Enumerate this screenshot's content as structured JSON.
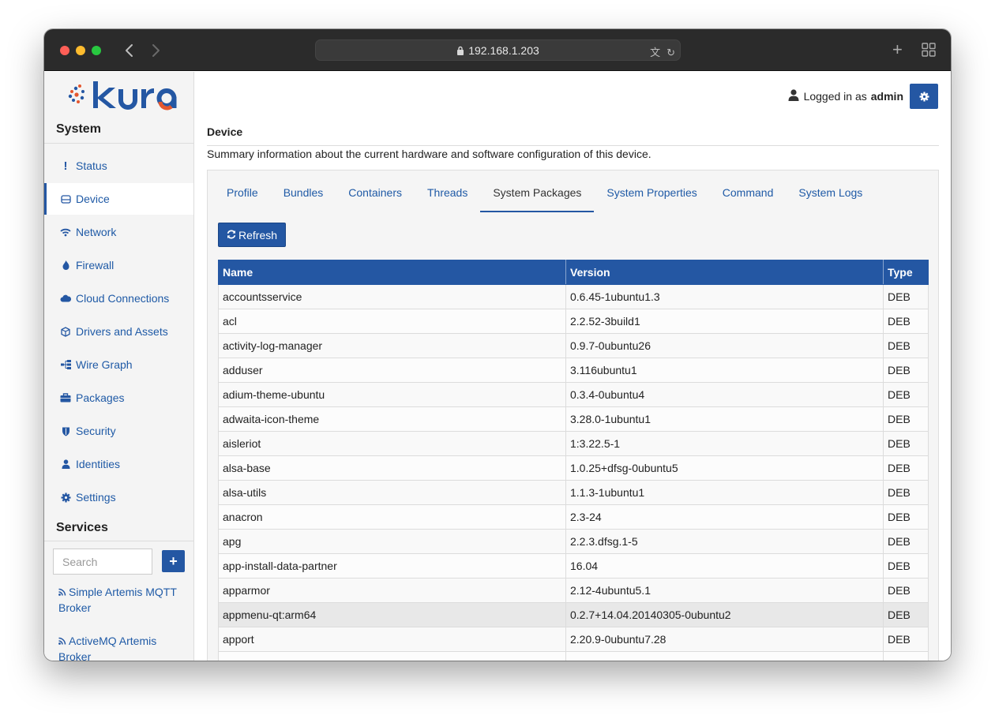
{
  "browser": {
    "url": "192.168.1.203",
    "colors": {
      "close": "#ff5f57",
      "minimize": "#febc2e",
      "maximize": "#28c840"
    }
  },
  "sidebar": {
    "system_heading": "System",
    "items": [
      {
        "label": "Status",
        "icon": "exclamation-icon"
      },
      {
        "label": "Device",
        "icon": "hdd-icon",
        "active": true
      },
      {
        "label": "Network",
        "icon": "wifi-icon"
      },
      {
        "label": "Firewall",
        "icon": "fire-icon"
      },
      {
        "label": "Cloud Connections",
        "icon": "cloud-icon"
      },
      {
        "label": "Drivers and Assets",
        "icon": "cube-icon"
      },
      {
        "label": "Wire Graph",
        "icon": "sitemap-icon"
      },
      {
        "label": "Packages",
        "icon": "briefcase-icon"
      },
      {
        "label": "Security",
        "icon": "shield-icon"
      },
      {
        "label": "Identities",
        "icon": "user-icon"
      },
      {
        "label": "Settings",
        "icon": "cog-icon"
      }
    ],
    "services_heading": "Services",
    "search_placeholder": "Search",
    "add_label": "+",
    "services": [
      {
        "label": "Simple Artemis MQTT Broker",
        "icon": "rss-icon"
      },
      {
        "label": "ActiveMQ Artemis Broker",
        "icon": "rss-icon"
      }
    ]
  },
  "header": {
    "logged_in_text": "Logged in as",
    "username": "admin"
  },
  "main": {
    "title": "Device",
    "description": "Summary information about the current hardware and software configuration of this device.",
    "tabs": [
      {
        "label": "Profile"
      },
      {
        "label": "Bundles"
      },
      {
        "label": "Containers"
      },
      {
        "label": "Threads"
      },
      {
        "label": "System Packages",
        "active": true
      },
      {
        "label": "System Properties"
      },
      {
        "label": "Command"
      },
      {
        "label": "System Logs"
      }
    ],
    "refresh_label": "Refresh",
    "table": {
      "columns": [
        "Name",
        "Version",
        "Type"
      ],
      "rows": [
        [
          "accountsservice",
          "0.6.45-1ubuntu1.3",
          "DEB"
        ],
        [
          "acl",
          "2.2.52-3build1",
          "DEB"
        ],
        [
          "activity-log-manager",
          "0.9.7-0ubuntu26",
          "DEB"
        ],
        [
          "adduser",
          "3.116ubuntu1",
          "DEB"
        ],
        [
          "adium-theme-ubuntu",
          "0.3.4-0ubuntu4",
          "DEB"
        ],
        [
          "adwaita-icon-theme",
          "3.28.0-1ubuntu1",
          "DEB"
        ],
        [
          "aisleriot",
          "1:3.22.5-1",
          "DEB"
        ],
        [
          "alsa-base",
          "1.0.25+dfsg-0ubuntu5",
          "DEB"
        ],
        [
          "alsa-utils",
          "1.1.3-1ubuntu1",
          "DEB"
        ],
        [
          "anacron",
          "2.3-24",
          "DEB"
        ],
        [
          "apg",
          "2.2.3.dfsg.1-5",
          "DEB"
        ],
        [
          "app-install-data-partner",
          "16.04",
          "DEB"
        ],
        [
          "apparmor",
          "2.12-4ubuntu5.1",
          "DEB"
        ],
        [
          "appmenu-qt:arm64",
          "0.2.7+14.04.20140305-0ubuntu2",
          "DEB"
        ],
        [
          "apport",
          "2.20.9-0ubuntu7.28",
          "DEB"
        ],
        [
          "",
          "",
          ""
        ]
      ]
    }
  },
  "colors": {
    "accent": "#2457a3",
    "link": "#1f5aa6",
    "logo_text": "#2457a3",
    "logo_accent": "#e4572e"
  }
}
